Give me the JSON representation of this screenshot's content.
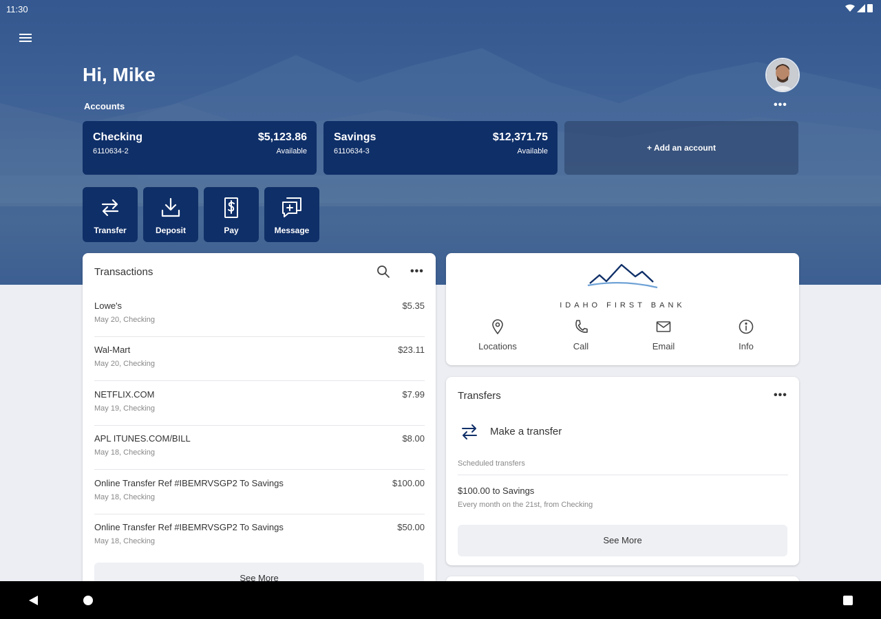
{
  "status_bar": {
    "time": "11:30"
  },
  "header": {
    "greeting": "Hi, Mike",
    "accounts_label": "Accounts",
    "accounts_more": "•••"
  },
  "accounts": [
    {
      "name": "Checking",
      "number": "6110634-2",
      "balance": "$5,123.86",
      "balance_label": "Available"
    },
    {
      "name": "Savings",
      "number": "6110634-3",
      "balance": "$12,371.75",
      "balance_label": "Available"
    }
  ],
  "add_account_label": "+ Add an account",
  "actions": [
    {
      "label": "Transfer",
      "icon": "transfer-icon"
    },
    {
      "label": "Deposit",
      "icon": "deposit-icon"
    },
    {
      "label": "Pay",
      "icon": "pay-icon"
    },
    {
      "label": "Message",
      "icon": "message-icon"
    }
  ],
  "transactions": {
    "title": "Transactions",
    "more": "•••",
    "items": [
      {
        "payee": "Lowe's",
        "meta": "May 20, Checking",
        "amount": "$5.35"
      },
      {
        "payee": "Wal-Mart",
        "meta": "May 20, Checking",
        "amount": "$23.11"
      },
      {
        "payee": "NETFLIX.COM",
        "meta": "May 19, Checking",
        "amount": "$7.99"
      },
      {
        "payee": "APL ITUNES.COM/BILL",
        "meta": "May 18, Checking",
        "amount": "$8.00"
      },
      {
        "payee": "Online Transfer Ref #IBEMRVSGP2 To Savings",
        "meta": "May 18, Checking",
        "amount": "$100.00"
      },
      {
        "payee": "Online Transfer Ref #IBEMRVSGP2 To Savings",
        "meta": "May 18, Checking",
        "amount": "$50.00"
      }
    ],
    "see_more": "See More"
  },
  "bank": {
    "name": "IDAHO FIRST BANK",
    "contacts": [
      {
        "label": "Locations",
        "icon": "location-pin-icon"
      },
      {
        "label": "Call",
        "icon": "phone-icon"
      },
      {
        "label": "Email",
        "icon": "email-icon"
      },
      {
        "label": "Info",
        "icon": "info-icon"
      }
    ]
  },
  "transfers": {
    "title": "Transfers",
    "more": "•••",
    "make_transfer": "Make a transfer",
    "scheduled_label": "Scheduled transfers",
    "scheduled": [
      {
        "title": "$100.00 to Savings",
        "detail": "Every month on the 21st, from Checking"
      }
    ],
    "see_more": "See More"
  },
  "colors": {
    "hero_blue": "#3e6196",
    "card_navy": "#0f2f68",
    "page_background": "#eceef3"
  }
}
